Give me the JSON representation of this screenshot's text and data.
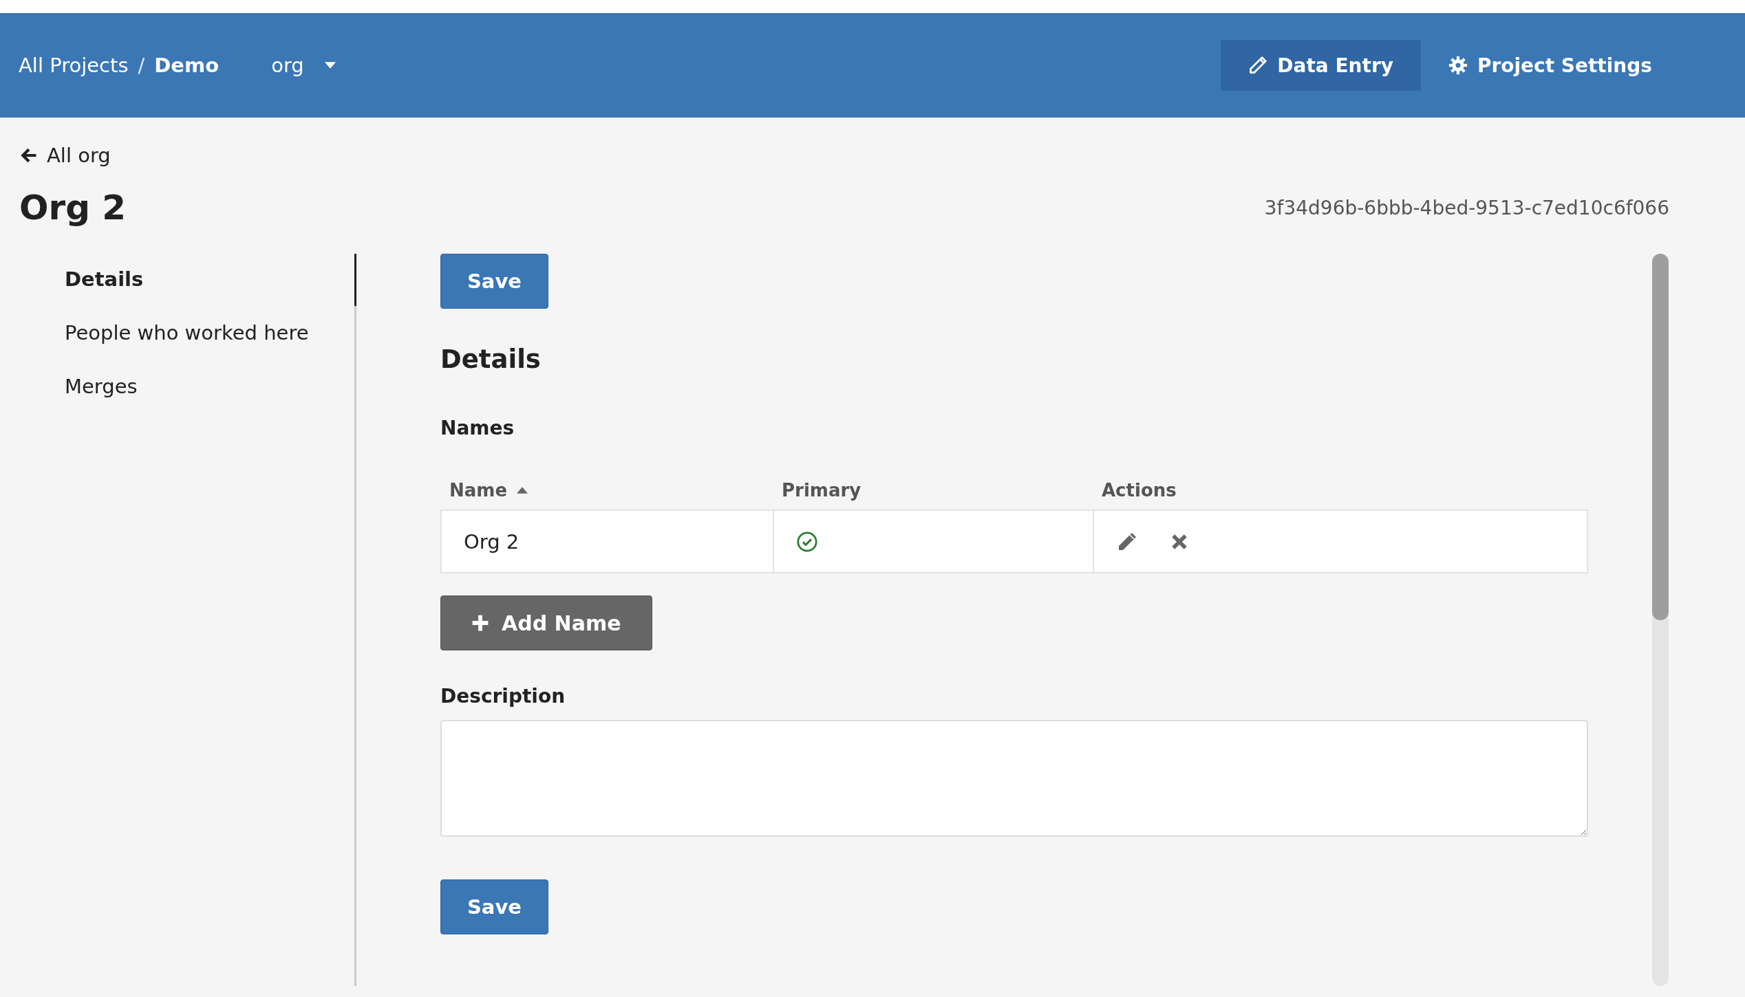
{
  "header": {
    "breadcrumb_separator": "/",
    "breadcrumbs": [
      {
        "label": "All Projects",
        "current": false
      },
      {
        "label": "Demo",
        "current": true
      }
    ],
    "entity_menu": {
      "label": "org"
    },
    "nav": [
      {
        "label": "Data Entry",
        "kind": "entry",
        "selected": true
      },
      {
        "label": "Project Settings",
        "kind": "settings",
        "selected": false
      }
    ]
  },
  "back_link": "All org",
  "title": "Org 2",
  "record_id": "3f34d96b-6bbb-4bed-9513-c7ed10c6f066",
  "sidebar": {
    "items": [
      {
        "label": "Details",
        "selected": true
      },
      {
        "label": "People who worked here",
        "selected": false
      },
      {
        "label": "Merges",
        "selected": false
      }
    ]
  },
  "save_buttons": [
    "Save",
    "Save"
  ],
  "section_title": "Details",
  "names": {
    "title": "Names",
    "columns": [
      {
        "label": "Name",
        "sorted": true
      },
      {
        "label": "Primary",
        "sorted": false
      },
      {
        "label": "Actions",
        "sorted": false
      }
    ],
    "rows": [
      {
        "name": "Org 2",
        "primary": true
      }
    ],
    "add_button": "Add Name"
  },
  "description": {
    "label": "Description"
  }
}
